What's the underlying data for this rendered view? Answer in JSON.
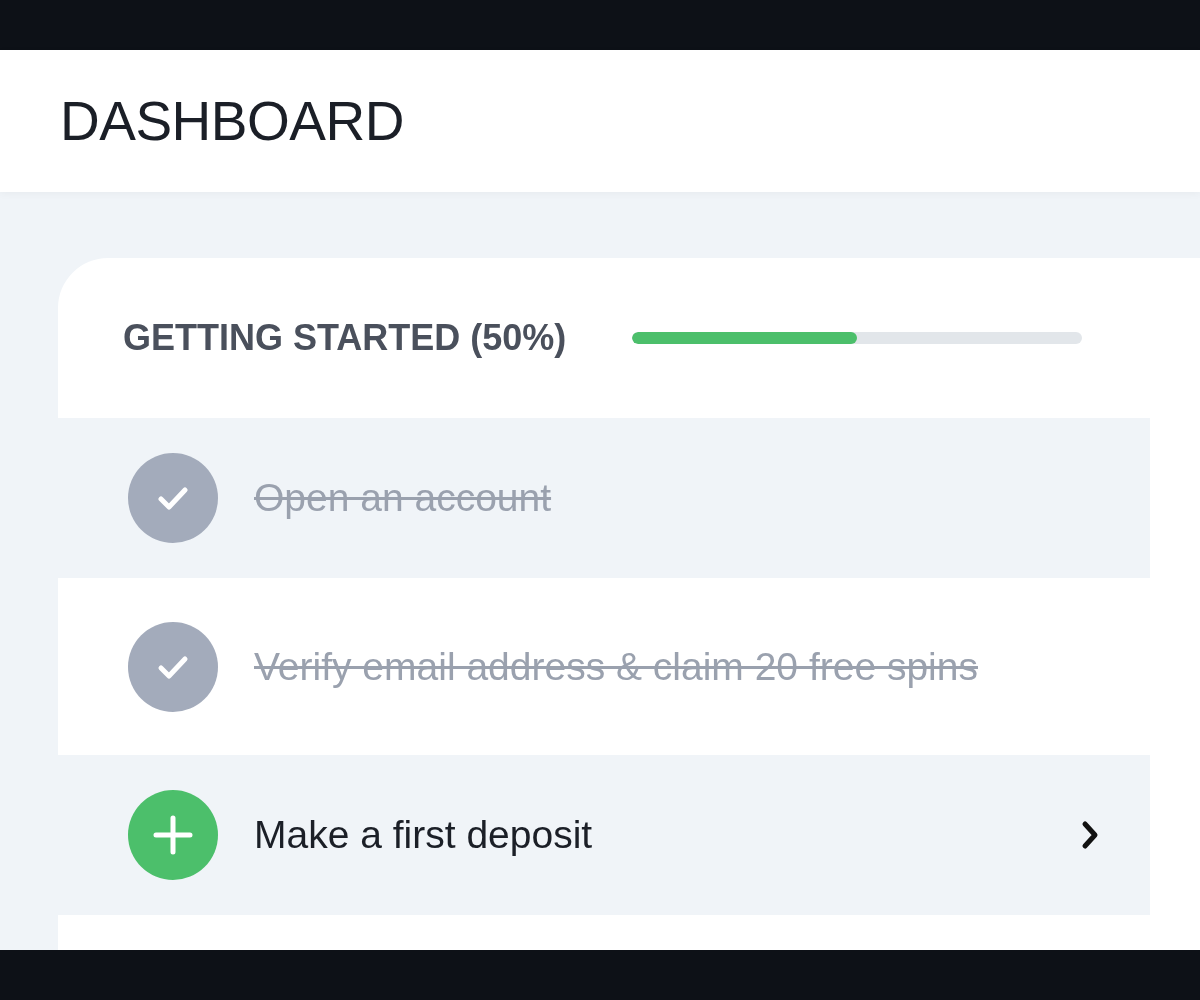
{
  "header": {
    "title": "DASHBOARD"
  },
  "getting_started": {
    "title": "GETTING STARTED (50%)",
    "level": 0.5,
    "tasks": [
      {
        "label": "Open an account",
        "done": true
      },
      {
        "label": "Verify email address & claim 20 free spins",
        "done": true
      },
      {
        "label": "Make a first deposit",
        "done": false
      }
    ]
  }
}
